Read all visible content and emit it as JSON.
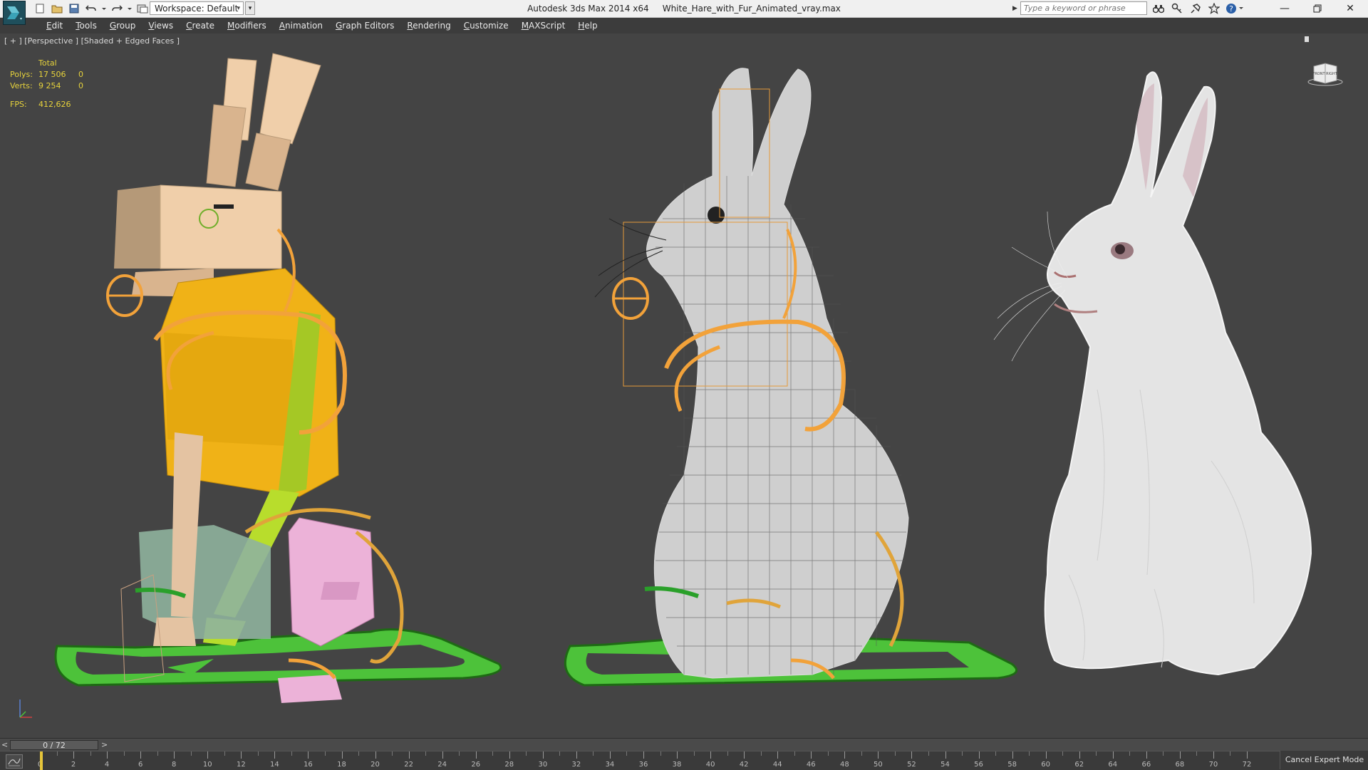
{
  "titlebar": {
    "app_title": "Autodesk 3ds Max  2014 x64",
    "file_name": "White_Hare_with_Fur_Animated_vray.max",
    "workspace_label": "Workspace: Default",
    "search_placeholder": "Type a keyword or phrase"
  },
  "menu": {
    "items": [
      {
        "underline": "E",
        "rest": "dit"
      },
      {
        "underline": "T",
        "rest": "ools"
      },
      {
        "underline": "G",
        "rest": "roup"
      },
      {
        "underline": "V",
        "rest": "iews"
      },
      {
        "underline": "C",
        "rest": "reate"
      },
      {
        "underline": "M",
        "rest": "odifiers"
      },
      {
        "underline": "A",
        "rest": "nimation"
      },
      {
        "underline": "G",
        "rest": "raph Editors"
      },
      {
        "underline": "R",
        "rest": "endering"
      },
      {
        "underline": "C",
        "rest": "ustomize"
      },
      {
        "underline": "M",
        "rest": "AXScript"
      },
      {
        "underline": "H",
        "rest": "elp"
      }
    ]
  },
  "viewport": {
    "label": "[ + ] [Perspective ] [Shaded + Edged Faces ]",
    "stats": {
      "header": "Total",
      "polys_label": "Polys:",
      "polys_total": "17 506",
      "polys_sel": "0",
      "verts_label": "Verts:",
      "verts_total": "9 254",
      "verts_sel": "0",
      "fps_label": "FPS:",
      "fps_value": "412,626"
    },
    "viewcube": {
      "front": "FRONT",
      "right": "RIGHT"
    }
  },
  "timeline": {
    "frame_display": "0 / 72",
    "prev_label": "<",
    "next_label": ">",
    "current_frame": 0,
    "total_frames": 72,
    "tick_labels": [
      "0",
      "2",
      "4",
      "6",
      "8",
      "10",
      "12",
      "14",
      "16",
      "18",
      "20",
      "22",
      "24",
      "26",
      "28",
      "30",
      "32",
      "34",
      "36",
      "38",
      "40",
      "42",
      "44",
      "46",
      "48",
      "50",
      "52",
      "54",
      "56",
      "58",
      "60",
      "62",
      "64",
      "66",
      "68",
      "70",
      "72"
    ]
  },
  "status": {
    "cancel_expert": "Cancel Expert Mode"
  },
  "colors": {
    "viewport_bg": "#444444",
    "stats_yellow": "#e6d23c",
    "rig_orange": "#f2a23a",
    "rig_green": "#4cc23a",
    "playhead": "#e6c53a"
  }
}
